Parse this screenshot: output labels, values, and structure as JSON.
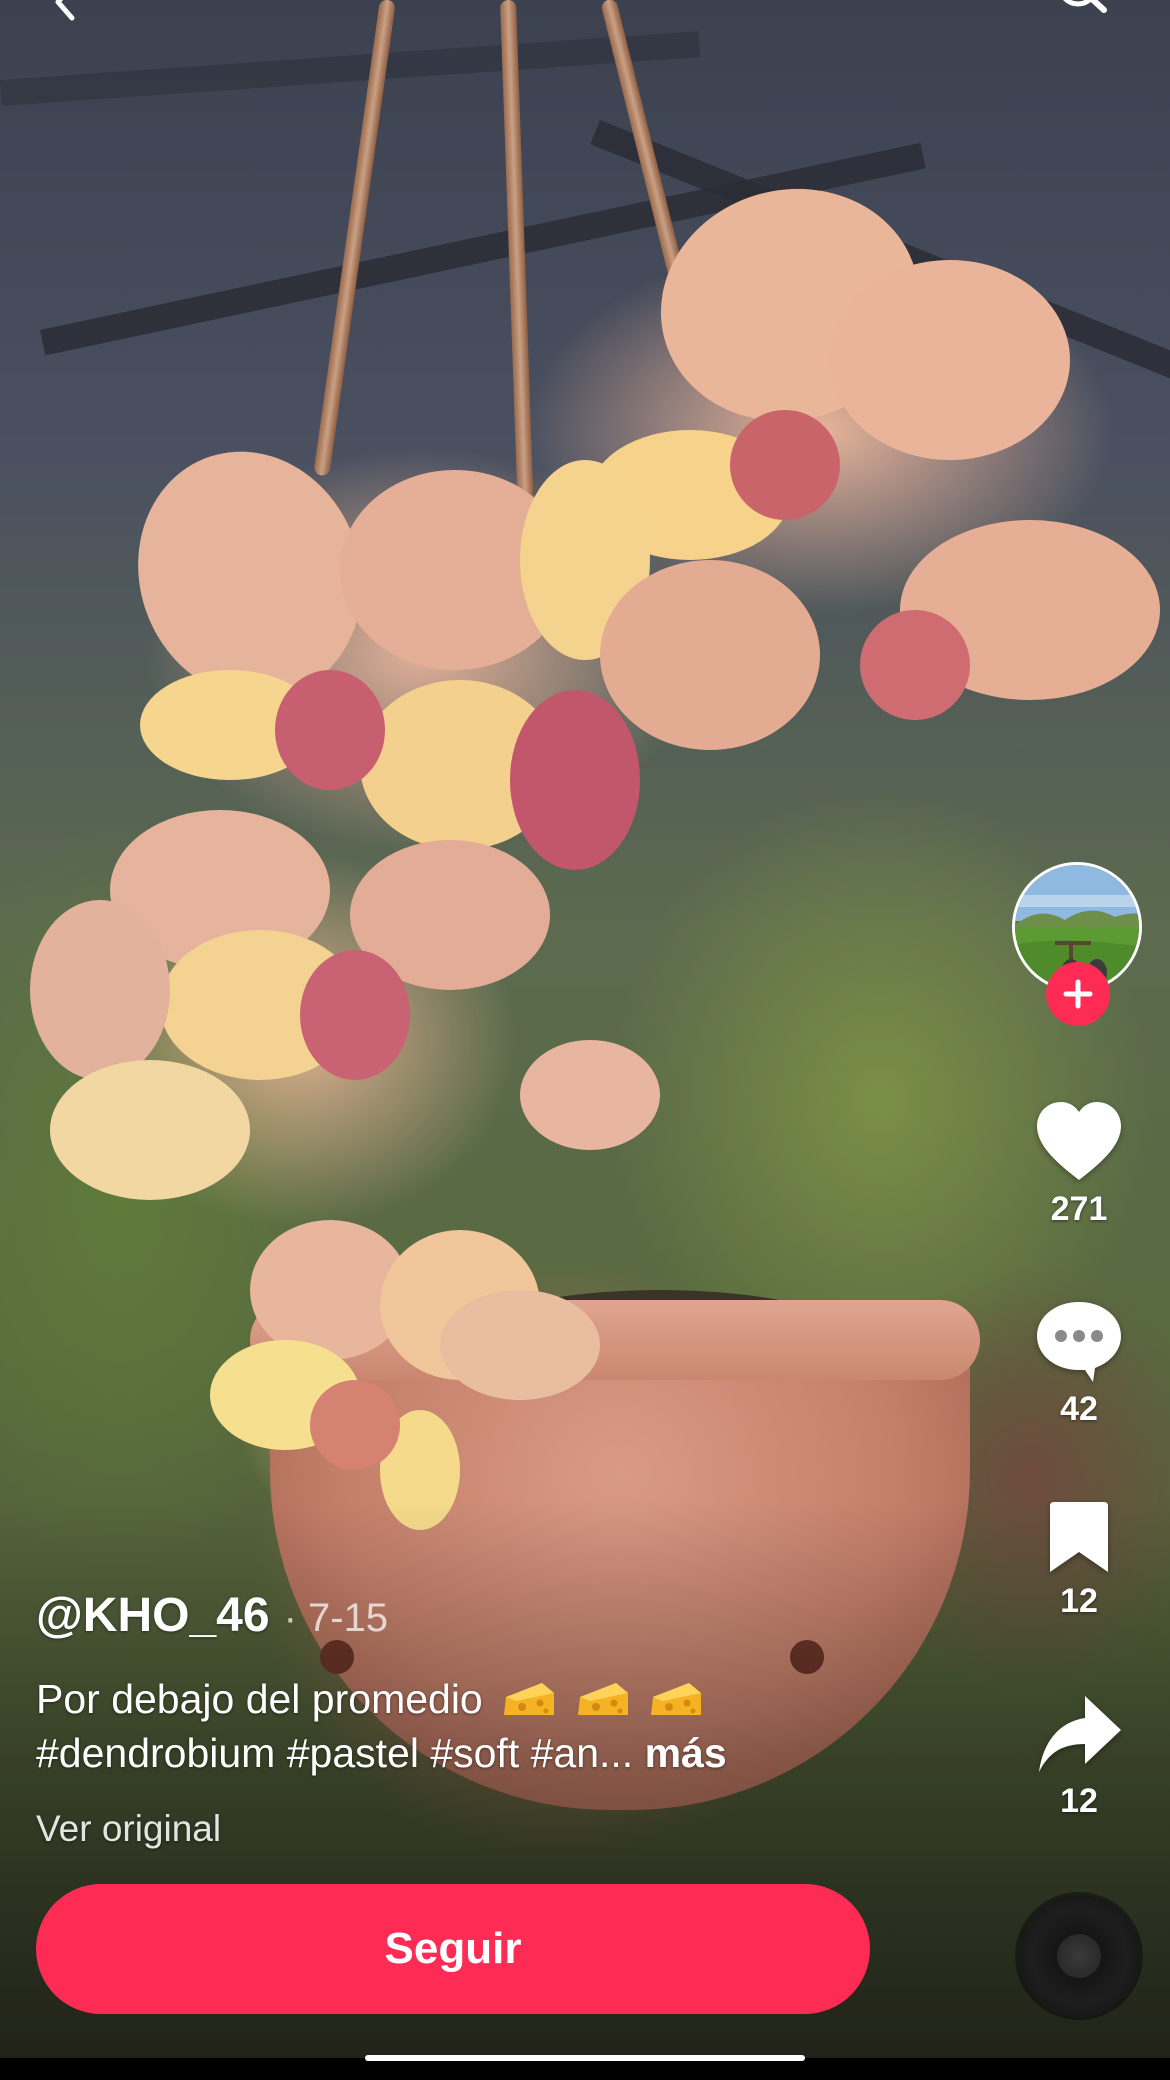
{
  "post": {
    "username": "@KHO_46",
    "date": "· 7-15",
    "caption_text": "Por debajo del promedio",
    "caption_emojis": [
      "cheese-icon",
      "cheese-icon",
      "cheese-icon"
    ],
    "hashtags_text": "#dendrobium #pastel #soft #an...",
    "more_label": "más",
    "see_original_label": "Ver original"
  },
  "actions": {
    "likes": "271",
    "comments": "42",
    "saves": "12",
    "shares": "12"
  },
  "follow_button_label": "Seguir",
  "icons": {
    "back": "chevron-left-icon",
    "search": "search-icon",
    "like": "heart-icon",
    "comment": "comment-icon",
    "save": "bookmark-icon",
    "share": "share-icon",
    "follow_plus": "plus-icon",
    "music": "music-disc-icon"
  },
  "colors": {
    "accent": "#fe2c55",
    "text": "#ffffff"
  }
}
